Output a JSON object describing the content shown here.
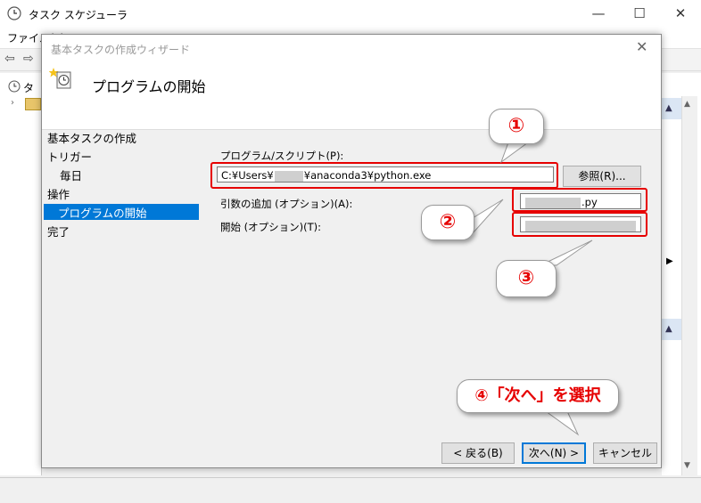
{
  "bg_window": {
    "title": "タスク スケジューラ",
    "menu_visible": "ファイル(F)",
    "tree_item": "タ"
  },
  "dialog": {
    "title": "基本タスクの作成ウィザード",
    "header": "プログラムの開始",
    "sidebar": [
      "基本タスクの作成",
      "トリガー",
      "毎日",
      "操作",
      "プログラムの開始",
      "完了"
    ],
    "program_label": "プログラム/スクリプト(P):",
    "program_value_prefix": "C:¥Users¥",
    "program_value_suffix": "¥anaconda3¥python.exe",
    "browse_label": "参照(R)...",
    "args_label": "引数の追加 (オプション)(A):",
    "args_value": ".py",
    "start_label": "開始 (オプション)(T):",
    "start_value": "",
    "back_label": "< 戻る(B)",
    "next_label": "次へ(N) >",
    "cancel_label": "キャンセル"
  },
  "annotations": {
    "one": "①",
    "two": "②",
    "three": "③",
    "four": "④「次へ」を選択"
  },
  "colors": {
    "annotation": "#e60000",
    "selection": "#0078d7"
  }
}
